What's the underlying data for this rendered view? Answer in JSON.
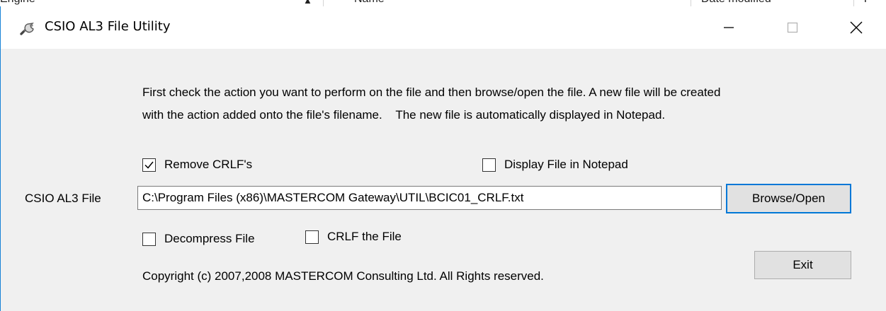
{
  "background_window": {
    "columns": [
      "Engine",
      "Name",
      "Date modified",
      "T"
    ]
  },
  "window": {
    "title": "CSIO AL3 File Utility",
    "app_icon": "wrench-key-icon",
    "controls": {
      "minimize_icon": "minimize-icon",
      "maximize_icon": "maximize-icon",
      "close_icon": "close-icon"
    }
  },
  "description": {
    "line1": "First check the action you want to perform on the file and then browse/open the file. A new file will be created",
    "line2": "with the action added onto the file's filename.    The new file is automatically displayed in Notepad."
  },
  "options": {
    "remove_crlf": {
      "label": "Remove CRLF's",
      "checked": true
    },
    "display_notepad": {
      "label": "Display File in Notepad",
      "checked": false
    },
    "decompress": {
      "label": "Decompress File",
      "checked": false
    },
    "crlf_file": {
      "label": "CRLF the File",
      "checked": false
    }
  },
  "file": {
    "label": "CSIO AL3 File",
    "value": "C:\\Program Files (x86)\\MASTERCOM Gateway\\UTIL\\BCIC01_CRLF.txt"
  },
  "buttons": {
    "browse": "Browse/Open",
    "exit": "Exit"
  },
  "copyright": "Copyright (c) 2007,2008 MASTERCOM Consulting Ltd. All Rights reserved.",
  "colors": {
    "accent": "#0078d7",
    "dialog_bg": "#f0f0f0",
    "titlebar_bg": "#ffffff"
  }
}
